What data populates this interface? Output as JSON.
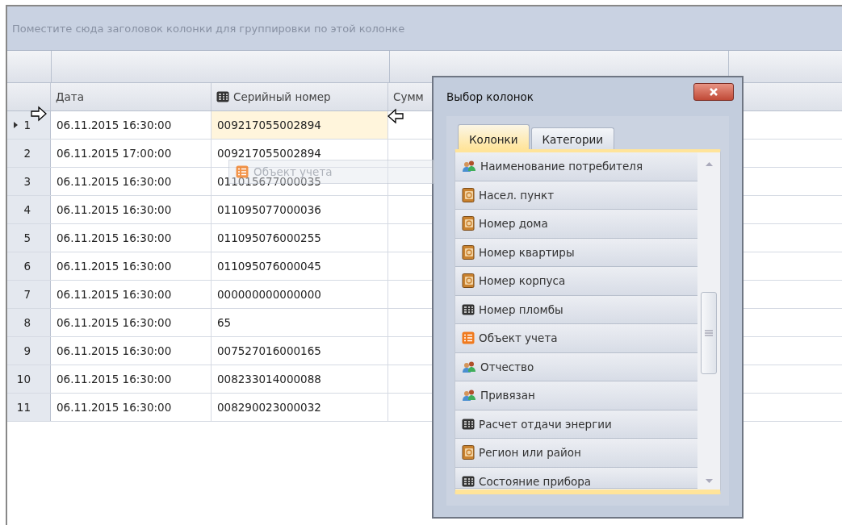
{
  "group_panel": {
    "hint": "Поместите сюда заголовок колонки для группировки по этой колонке"
  },
  "columns": [
    {
      "label": "Дата",
      "kind": "plain"
    },
    {
      "label": "Серийный номер",
      "kind": "number"
    },
    {
      "label": "Сумм",
      "kind": "plain"
    }
  ],
  "rows": [
    {
      "number": "1",
      "date": "06.11.2015 16:30:00",
      "serial": "009217055002894",
      "selected": true
    },
    {
      "number": "2",
      "date": "06.11.2015 17:00:00",
      "serial": "009217055002894",
      "selected": false
    },
    {
      "number": "3",
      "date": "06.11.2015 16:30:00",
      "serial": "011015677000035",
      "selected": false
    },
    {
      "number": "4",
      "date": "06.11.2015 16:30:00",
      "serial": "011095077000036",
      "selected": false
    },
    {
      "number": "5",
      "date": "06.11.2015 16:30:00",
      "serial": "011095076000255",
      "selected": false
    },
    {
      "number": "6",
      "date": "06.11.2015 16:30:00",
      "serial": "011095076000045",
      "selected": false
    },
    {
      "number": "7",
      "date": "06.11.2015 16:30:00",
      "serial": "000000000000000",
      "selected": false
    },
    {
      "number": "8",
      "date": "06.11.2015 16:30:00",
      "serial": "65",
      "selected": false
    },
    {
      "number": "9",
      "date": "06.11.2015 16:30:00",
      "serial": "007527016000165",
      "selected": false
    },
    {
      "number": "10",
      "date": "06.11.2015 16:30:00",
      "serial": "008233014000088",
      "selected": false
    },
    {
      "number": "11",
      "date": "06.11.2015 16:30:00",
      "serial": "008290023000032",
      "selected": false
    }
  ],
  "drag_ghost": {
    "label": "Объект учета",
    "kind": "table"
  },
  "dialog": {
    "title": "Выбор колонок",
    "tabs": [
      {
        "label": "Колонки",
        "selected": true
      },
      {
        "label": "Категории",
        "selected": false
      }
    ],
    "items": [
      {
        "label": "Наименование потребителя",
        "kind": "people"
      },
      {
        "label": "Насел. пункт",
        "kind": "book"
      },
      {
        "label": "Номер дома",
        "kind": "book"
      },
      {
        "label": "Номер квартиры",
        "kind": "book"
      },
      {
        "label": "Номер корпуса",
        "kind": "book"
      },
      {
        "label": "Номер пломбы",
        "kind": "number"
      },
      {
        "label": "Объект учета",
        "kind": "table"
      },
      {
        "label": "Отчество",
        "kind": "people"
      },
      {
        "label": "Привязан",
        "kind": "people"
      },
      {
        "label": "Расчет отдачи энергии",
        "kind": "number"
      },
      {
        "label": "Регион или район",
        "kind": "book"
      },
      {
        "label": "Состояние прибора",
        "kind": "number"
      }
    ]
  }
}
